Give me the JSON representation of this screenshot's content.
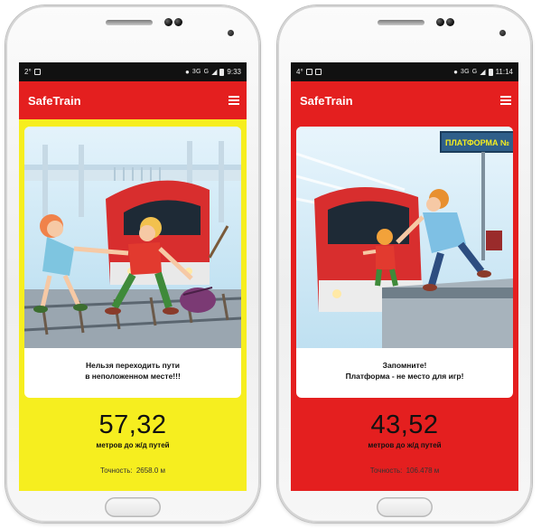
{
  "phones": [
    {
      "status": {
        "temp": "2°",
        "network": "3G",
        "signal_text": "G",
        "time": "9:33"
      },
      "app": {
        "title": "SafeTrain"
      },
      "theme": {
        "background": "#f6ee1f",
        "appbar": "#e41f1f"
      },
      "card": {
        "line1": "Нельзя переходить пути",
        "line2": "в неположенном месте!!!"
      },
      "distance": {
        "value": "57,32",
        "label": "метров до ж/д путей"
      },
      "accuracy": {
        "label": "Точность:",
        "value": "2658.0 м"
      },
      "icons": [
        "android-icon",
        "location-pin-icon",
        "signal-icon",
        "battery-icon",
        "menu-icon"
      ]
    },
    {
      "status": {
        "temp": "4°",
        "network": "3G",
        "signal_text": "G",
        "time": "11:14"
      },
      "app": {
        "title": "SafeTrain"
      },
      "theme": {
        "background": "#e41f1f",
        "appbar": "#e41f1f"
      },
      "card": {
        "sign": "ПЛАТФОРМА №",
        "line1": "Запомните!",
        "line2": "Платформа - не место для игр!"
      },
      "distance": {
        "value": "43,52",
        "label": "метров до ж/д путей"
      },
      "accuracy": {
        "label": "Точность:",
        "value": "106.478 м"
      },
      "icons": [
        "image-icon",
        "android-icon",
        "location-pin-icon",
        "signal-icon",
        "battery-icon",
        "menu-icon"
      ]
    }
  ]
}
